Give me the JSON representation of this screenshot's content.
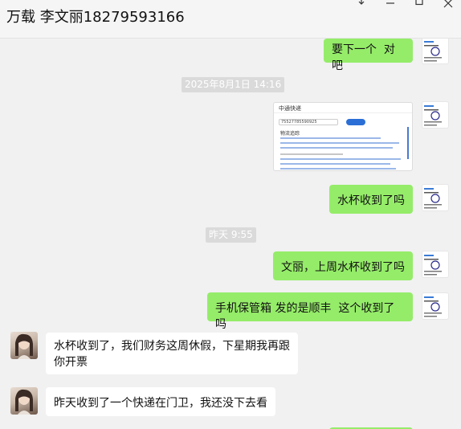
{
  "window": {
    "title": "万载 李文丽18279593166"
  },
  "messages": [
    {
      "type": "text",
      "side": "self",
      "text": "要下一个  对吧"
    },
    {
      "type": "time",
      "text": "2025年8月1日 14:16"
    },
    {
      "type": "image",
      "side": "self",
      "image": {
        "app": "中通快递",
        "tracking": "75527785590925",
        "query_button": "查询",
        "section": "物流追踪"
      }
    },
    {
      "type": "text",
      "side": "self",
      "text": "水杯收到了吗"
    },
    {
      "type": "time",
      "text": "昨天 9:55"
    },
    {
      "type": "text",
      "side": "self",
      "text": "文丽，上周水杯收到了吗"
    },
    {
      "type": "text",
      "side": "self",
      "text": "手机保管箱 发的是顺丰  这个收到了吗"
    },
    {
      "type": "text",
      "side": "other",
      "text": "水杯收到了，我们财务这周休假，下星期我再跟你开票"
    },
    {
      "type": "text",
      "side": "other",
      "text": "昨天收到了一个快递在门卫，我还没下去看"
    }
  ],
  "colors": {
    "self_bubble": "#95ec69",
    "other_bubble": "#ffffff",
    "chat_bg": "#f1f1f1",
    "time_badge": "#dadada",
    "link_blue": "#2b6fd6"
  },
  "icons": {
    "pin": "pin-icon",
    "minimize": "minimize-icon",
    "maximize": "maximize-icon",
    "close": "close-icon"
  }
}
